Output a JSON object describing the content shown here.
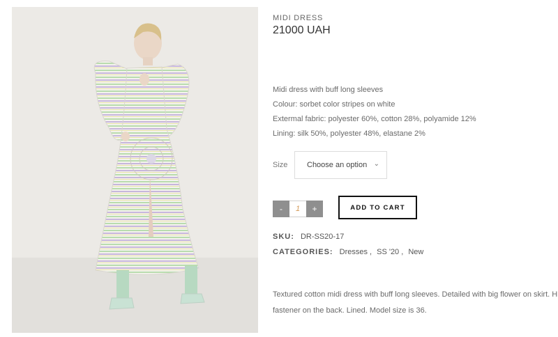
{
  "product": {
    "title": "MIDI DRESS",
    "price": "21000 UAH",
    "description_lines": [
      "Midi dress with buff long sleeves",
      "Colour: sorbet color stripes on white",
      "Extermal fabric: polyester 60%, cotton 28%, polyamide 12%",
      "Lining: silk 50%, polyester 48%, elastane 2%"
    ],
    "size_label": "Size",
    "size_select_value": "Choose an option",
    "quantity": {
      "minus": "-",
      "value": "1",
      "plus": "+"
    },
    "add_to_cart_label": "ADD TO CART",
    "sku_key": "SKU:",
    "sku_value": "DR-SS20-17",
    "categories_key": "CATEGORIES:",
    "categories": [
      "Dresses",
      "SS '20",
      "New"
    ],
    "long_description_lines": [
      "Textured cotton midi dress with buff long sleeves. Detailed with big flower on skirt. H",
      "fastener on the back. Lined. Model size is 36."
    ]
  },
  "image": {
    "icon": "product-photo",
    "colors": {
      "background": "#ecebe7",
      "stripe_green": "#b9dcae",
      "stripe_lilac": "#c7b6dc",
      "sock": "#b7d9c1"
    }
  }
}
